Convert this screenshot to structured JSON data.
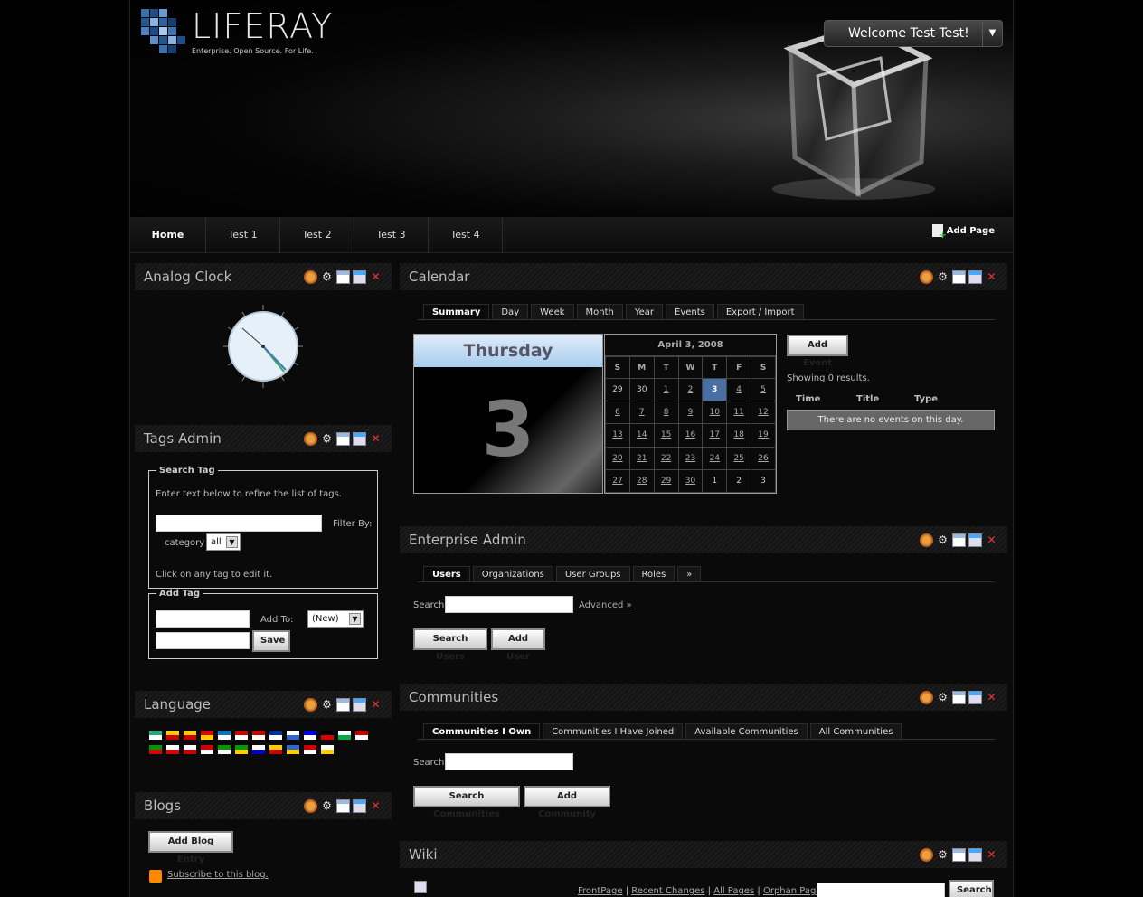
{
  "header": {
    "logo_text": "LIFERAY",
    "logo_tagline": "Enterprise. Open Source. For Life.",
    "welcome": "Welcome Test Test!"
  },
  "nav": {
    "items": [
      "Home",
      "Test 1",
      "Test 2",
      "Test 3",
      "Test 4"
    ],
    "add_page": "Add Page"
  },
  "clock": {
    "title": "Analog Clock"
  },
  "tags_admin": {
    "title": "Tags Admin",
    "search_legend": "Search Tag",
    "search_help": "Enter text below to refine the list of tags.",
    "filter_by": "Filter By:",
    "category_label": "category",
    "category_value": "all",
    "click_help": "Click on any tag to edit it.",
    "add_legend": "Add Tag",
    "add_to": "Add To:",
    "add_to_value": "(New)",
    "save": "Save"
  },
  "language": {
    "title": "Language"
  },
  "blogs": {
    "title": "Blogs",
    "add_entry": "Add Blog Entry",
    "subscribe": "Subscribe to this blog."
  },
  "calendar": {
    "title": "Calendar",
    "tabs": [
      "Summary",
      "Day",
      "Week",
      "Month",
      "Year",
      "Events",
      "Export / Import"
    ],
    "day_name": "Thursday",
    "day_number": "3",
    "month_title": "April 3, 2008",
    "weekdays": [
      "S",
      "M",
      "T",
      "W",
      "T",
      "F",
      "S"
    ],
    "weeks": [
      [
        "29",
        "30",
        "1",
        "2",
        "3",
        "4",
        "5"
      ],
      [
        "6",
        "7",
        "8",
        "9",
        "10",
        "11",
        "12"
      ],
      [
        "13",
        "14",
        "15",
        "16",
        "17",
        "18",
        "19"
      ],
      [
        "20",
        "21",
        "22",
        "23",
        "24",
        "25",
        "26"
      ],
      [
        "27",
        "28",
        "29",
        "30",
        "1",
        "2",
        "3"
      ]
    ],
    "add_event": "Add Event",
    "showing": "Showing 0 results.",
    "columns": [
      "Time",
      "Title",
      "Type"
    ],
    "empty": "There are no events on this day."
  },
  "enterprise_admin": {
    "title": "Enterprise Admin",
    "tabs": [
      "Users",
      "Organizations",
      "User Groups",
      "Roles",
      "»"
    ],
    "search_label": "Search",
    "advanced": "Advanced »",
    "search_btn": "Search Users",
    "add_btn": "Add User"
  },
  "communities": {
    "title": "Communities",
    "tabs": [
      "Communities I Own",
      "Communities I Have Joined",
      "Available Communities",
      "All Communities"
    ],
    "search_label": "Search",
    "search_btn": "Search Communities",
    "add_btn": "Add Community"
  },
  "wiki": {
    "title": "Wiki",
    "links": [
      "FrontPage",
      "Recent Changes",
      "All Pages",
      "Orphan Pages"
    ],
    "search_btn": "Search"
  },
  "colors": {
    "selected_day": "#4a6fa5",
    "close": "#e33333"
  }
}
